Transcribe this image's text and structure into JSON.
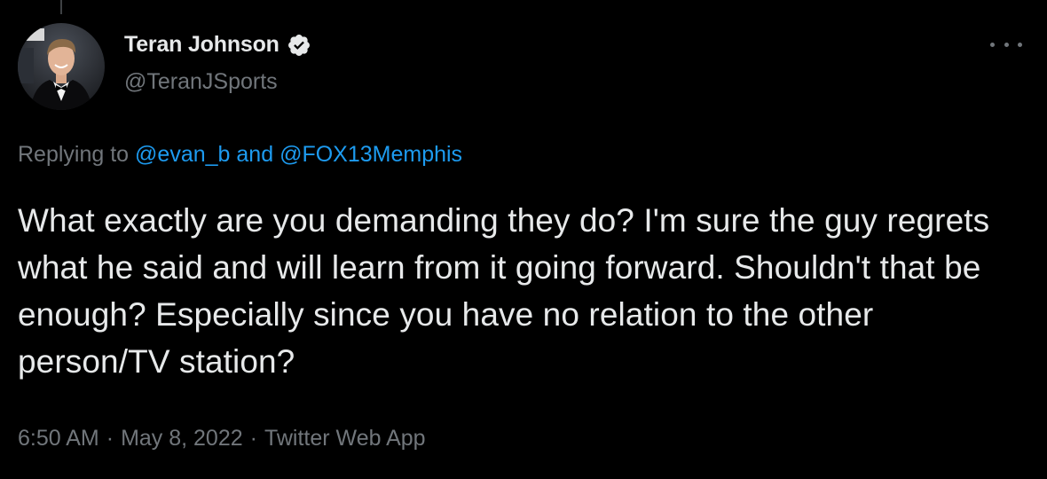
{
  "tweet": {
    "author": {
      "display_name": "Teran Johnson",
      "handle": "@TeranJSports",
      "verified": true,
      "avatar_icon": "profile-photo"
    },
    "reply": {
      "prefix": "Replying to",
      "mention_1": "@evan_b",
      "joiner": "and",
      "mention_2": "@FOX13Memphis"
    },
    "text": "What exactly are you demanding they do? I'm sure the guy regrets what he said and will learn from it going forward. Shouldn't that be enough? Especially since you have no relation to the other person/TV station?",
    "time": "6:50 AM",
    "date": "May 8, 2022",
    "source": "Twitter Web App",
    "separator": "·"
  },
  "icons": {
    "verified": "verified-badge-icon",
    "more": "more-options-icon"
  },
  "colors": {
    "background": "#000000",
    "text_primary": "#e7e9ea",
    "text_secondary": "#71767b",
    "link": "#1d9bf0"
  }
}
